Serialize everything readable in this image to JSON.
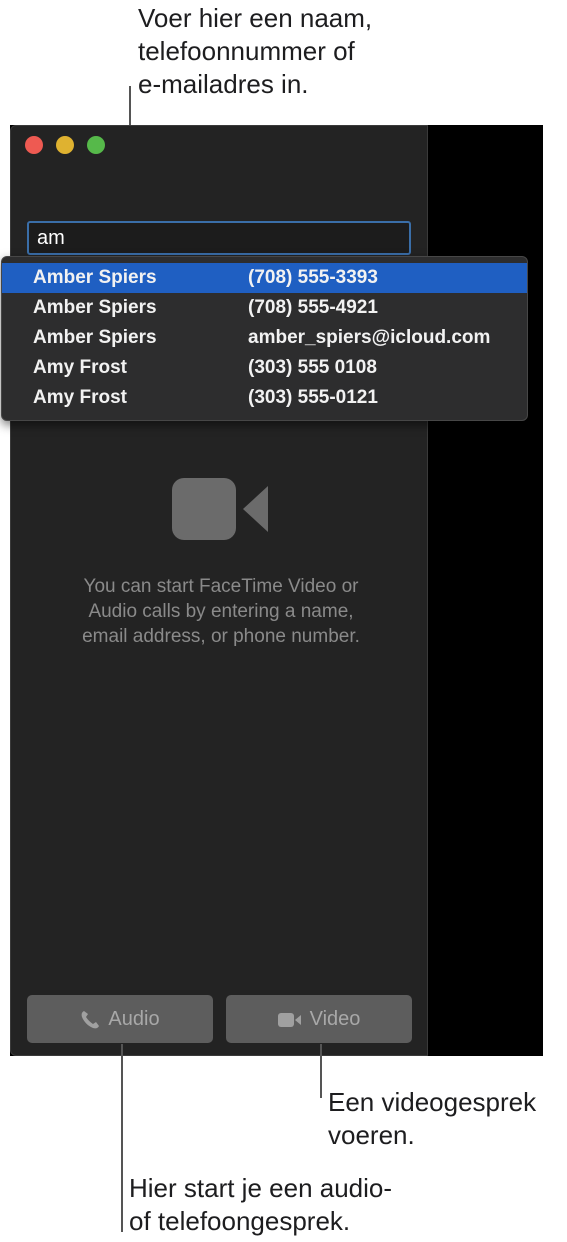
{
  "callouts": {
    "top": [
      "Voer hier een naam,",
      "telefoonnummer of",
      "e-mailadres in."
    ],
    "video": [
      "Een videogesprek",
      "voeren."
    ],
    "audio": [
      "Hier start je een audio-",
      "of telefoongesprek."
    ]
  },
  "search": {
    "value": "am"
  },
  "suggestions": [
    {
      "name": "Amber Spiers",
      "contact": "(708) 555-3393",
      "selected": true
    },
    {
      "name": "Amber Spiers",
      "contact": "(708) 555-4921"
    },
    {
      "name": "Amber Spiers",
      "contact": "amber_spiers@icloud.com"
    },
    {
      "name": "Amy Frost",
      "contact": "(303) 555 0108"
    },
    {
      "name": "Amy Frost",
      "contact": "(303) 555-0121"
    }
  ],
  "main": {
    "info": [
      "You can start FaceTime Video or",
      "Audio calls by entering a name,",
      "email address, or phone number."
    ]
  },
  "buttons": {
    "audio_label": "Audio",
    "video_label": "Video"
  },
  "colors": {
    "selection": "#1f5fc2",
    "search_border": "#3a6ea8"
  }
}
